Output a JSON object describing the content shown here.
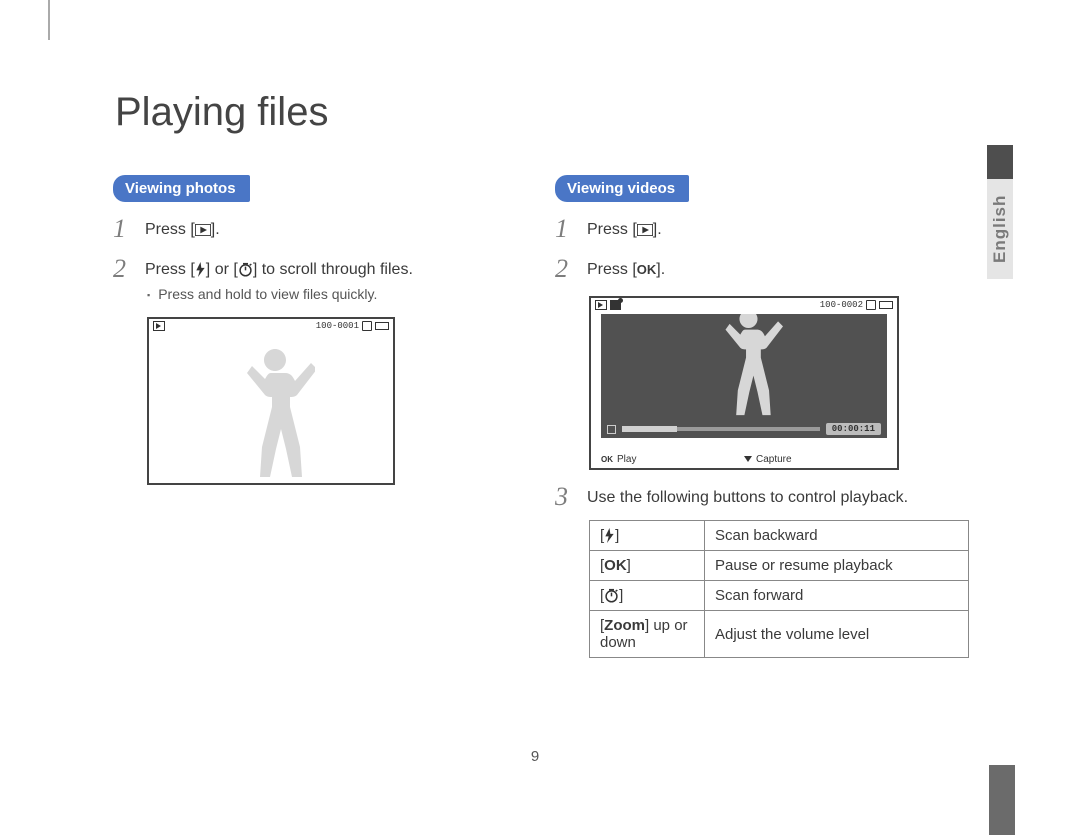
{
  "title": "Playing files",
  "language_tab": "English",
  "page_number": "9",
  "left": {
    "heading": "Viewing photos",
    "steps": {
      "1": {
        "pre": "Press [",
        "post": "]."
      },
      "2": {
        "pre": "Press [",
        "mid": "] or [",
        "post": "] to scroll through files."
      },
      "sub": "Press and hold to view files quickly."
    },
    "frame": {
      "file_id": "100-0001"
    }
  },
  "right": {
    "heading": "Viewing videos",
    "steps": {
      "1": {
        "pre": "Press [",
        "post": "]."
      },
      "2": {
        "pre": "Press [",
        "ok": "OK",
        "post": "]."
      },
      "3": "Use the following buttons to control playback."
    },
    "frame": {
      "file_id": "100-0002",
      "time": "00:00:11",
      "hint_play": "Play",
      "hint_capture": "Capture",
      "hint_ok": "OK"
    },
    "table": {
      "r1": "Scan backward",
      "r2": {
        "key": "OK",
        "desc": "Pause or resume playback"
      },
      "r3": "Scan forward",
      "r4": {
        "key_a": "Zoom",
        "key_b": " up or down",
        "desc": "Adjust the volume level"
      }
    }
  }
}
